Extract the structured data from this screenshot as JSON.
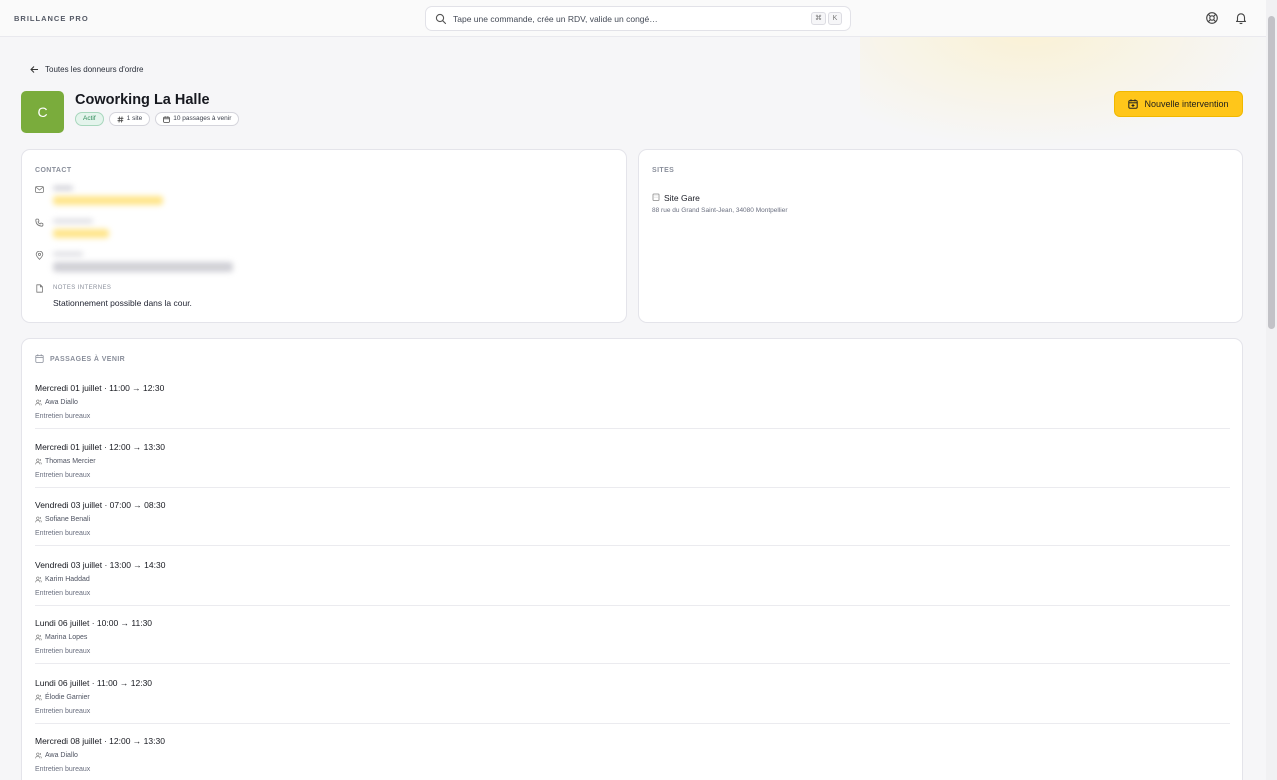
{
  "app": {
    "brand": "BRILLANCE PRO"
  },
  "search": {
    "placeholder": "Tape une commande, crée un RDV, valide un congé…",
    "kbd_cmd": "⌘",
    "kbd_key": "K"
  },
  "nav": {
    "back_label": "Toutes les donneurs d'ordre"
  },
  "client": {
    "initial": "C",
    "name": "Coworking La Halle",
    "status": "Actif",
    "sites_badge": "1 site",
    "passages_badge": "10 passages à venir"
  },
  "actions": {
    "new_intervention": "Nouvelle intervention"
  },
  "contact": {
    "title": "CONTACT",
    "notes_label": "NOTES INTERNES",
    "notes": "Stationnement possible dans la cour."
  },
  "sites": {
    "title": "SITES",
    "items": [
      {
        "name": "Site Gare",
        "address": "88 rue du Grand Saint-Jean, 34080 Montpellier"
      }
    ]
  },
  "passages": {
    "title": "PASSAGES À VENIR",
    "items": [
      {
        "when": "Mercredi 01 juillet · 11:00 → 12:30",
        "who": "Awa Diallo",
        "type": "Entretien bureaux"
      },
      {
        "when": "Mercredi 01 juillet · 12:00 → 13:30",
        "who": "Thomas Mercier",
        "type": "Entretien bureaux"
      },
      {
        "when": "Vendredi 03 juillet · 07:00 → 08:30",
        "who": "Sofiane Benali",
        "type": "Entretien bureaux"
      },
      {
        "when": "Vendredi 03 juillet · 13:00 → 14:30",
        "who": "Karim Haddad",
        "type": "Entretien bureaux"
      },
      {
        "when": "Lundi 06 juillet · 10:00 → 11:30",
        "who": "Marina Lopes",
        "type": "Entretien bureaux"
      },
      {
        "when": "Lundi 06 juillet · 11:00 → 12:30",
        "who": "Élodie Garnier",
        "type": "Entretien bureaux"
      },
      {
        "when": "Mercredi 08 juillet · 12:00 → 13:30",
        "who": "Awa Diallo",
        "type": "Entretien bureaux"
      }
    ]
  },
  "colors": {
    "accent": "#ffc61a",
    "avatar": "#7aac3c",
    "status_active": "#2e8a58"
  }
}
